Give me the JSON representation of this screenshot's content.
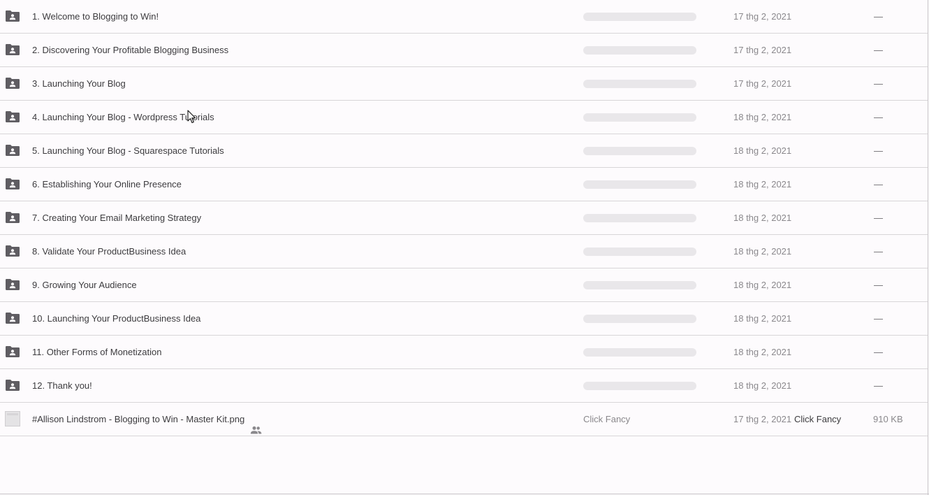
{
  "rows": [
    {
      "name": "1. Welcome to Blogging to Win!",
      "modified": "17 thg 2, 2021",
      "size": "—"
    },
    {
      "name": "2. Discovering Your Profitable Blogging Business",
      "modified": "17 thg 2, 2021",
      "size": "—"
    },
    {
      "name": "3. Launching Your Blog",
      "modified": "17 thg 2, 2021",
      "size": "—"
    },
    {
      "name": "4. Launching Your Blog - Wordpress Tutorials",
      "modified": "18 thg 2, 2021",
      "size": "—"
    },
    {
      "name": "5. Launching Your Blog - Squarespace Tutorials",
      "modified": "18 thg 2, 2021",
      "size": "—"
    },
    {
      "name": "6. Establishing Your Online Presence",
      "modified": "18 thg 2, 2021",
      "size": "—"
    },
    {
      "name": "7. Creating Your Email Marketing Strategy",
      "modified": "18 thg 2, 2021",
      "size": "—"
    },
    {
      "name": "8. Validate Your ProductBusiness Idea",
      "modified": "18 thg 2, 2021",
      "size": "—"
    },
    {
      "name": "9. Growing Your Audience",
      "modified": "18 thg 2, 2021",
      "size": "—"
    },
    {
      "name": "10. Launching Your ProductBusiness Idea",
      "modified": "18 thg 2, 2021",
      "size": "—"
    },
    {
      "name": "11. Other Forms of Monetization",
      "modified": "18 thg 2, 2021",
      "size": "—"
    },
    {
      "name": "12. Thank you!",
      "modified": "18 thg 2, 2021",
      "size": "—"
    }
  ],
  "file": {
    "name": "#Allison Lindstrom - Blogging to Win - Master Kit.png",
    "owner": "Click Fancy",
    "modified": "17 thg 2, 2021",
    "modified_by": "Click Fancy",
    "size": "910 KB",
    "shared_icon": "people-icon",
    "thumbnail_icon": "image-thumbnail"
  },
  "icons": {
    "folder": "shared-folder-icon",
    "cursor": "mouse-pointer"
  },
  "colors": {
    "background": "#fdfbfd",
    "icon": "#5f5d62",
    "divider": "#d8d6d8",
    "skeleton": "#e9e7ea",
    "text_primary": "#3c3b3e",
    "text_secondary": "#8a888c"
  }
}
